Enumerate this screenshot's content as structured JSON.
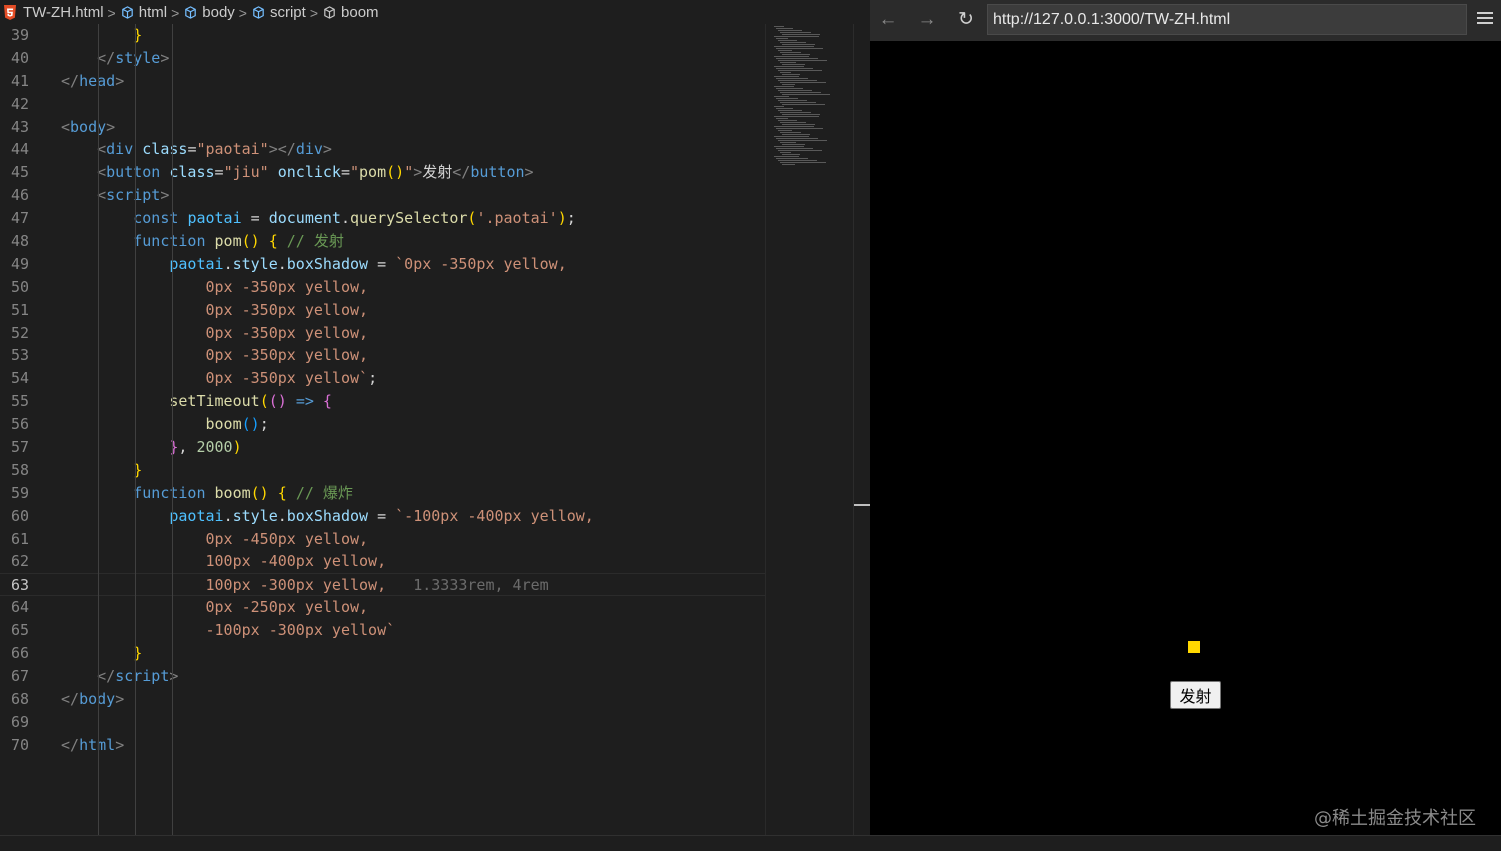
{
  "breadcrumb": {
    "file": "TW-ZH.html",
    "items": [
      "html",
      "body",
      "script",
      "boom"
    ]
  },
  "code_lines": [
    {
      "n": "39",
      "html": "        <span class=\"br\">}</span>"
    },
    {
      "n": "40",
      "html": "    <span class=\"t\">&lt;/</span><span class=\"tn\">style</span><span class=\"t\">&gt;</span>"
    },
    {
      "n": "41",
      "html": "<span class=\"t\">&lt;/</span><span class=\"tn\">head</span><span class=\"t\">&gt;</span>"
    },
    {
      "n": "42",
      "html": ""
    },
    {
      "n": "43",
      "html": "<span class=\"t\">&lt;</span><span class=\"tn\">body</span><span class=\"t\">&gt;</span>"
    },
    {
      "n": "44",
      "html": "    <span class=\"t\">&lt;</span><span class=\"tn\">div</span> <span class=\"an\">class</span>=<span class=\"av\">\"paotai\"</span><span class=\"t\">&gt;&lt;/</span><span class=\"tn\">div</span><span class=\"t\">&gt;</span>"
    },
    {
      "n": "45",
      "html": "    <span class=\"t\">&lt;</span><span class=\"tn\">button</span> <span class=\"an\">class</span>=<span class=\"av\">\"jiu\"</span> <span class=\"an\">onclick</span>=<span class=\"av\">\"</span><span class=\"fn\">pom</span><span class=\"br\">()</span><span class=\"av\">\"</span><span class=\"t\">&gt;</span>发射<span class=\"t\">&lt;/</span><span class=\"tn\">button</span><span class=\"t\">&gt;</span>"
    },
    {
      "n": "46",
      "html": "    <span class=\"t\">&lt;</span><span class=\"tn\">script</span><span class=\"t\">&gt;</span>"
    },
    {
      "n": "47",
      "html": "        <span class=\"kw\">const</span> <span class=\"vr\">paotai</span> = <span class=\"pr\">document</span>.<span class=\"fn\">querySelector</span><span class=\"br\">(</span><span class=\"av\">'.paotai'</span><span class=\"br\">)</span>;"
    },
    {
      "n": "48",
      "html": "        <span class=\"kw\">function</span> <span class=\"fn\">pom</span><span class=\"br\">()</span> <span class=\"br\">{</span> <span class=\"cm\">// 发射</span>"
    },
    {
      "n": "49",
      "html": "            <span class=\"vr\">paotai</span>.<span class=\"pr\">style</span>.<span class=\"pr\">boxShadow</span> = <span class=\"av\">`0px -350px yellow,</span>"
    },
    {
      "n": "50",
      "html": "                <span class=\"av\">0px -350px yellow,</span>"
    },
    {
      "n": "51",
      "html": "                <span class=\"av\">0px -350px yellow,</span>"
    },
    {
      "n": "52",
      "html": "                <span class=\"av\">0px -350px yellow,</span>"
    },
    {
      "n": "53",
      "html": "                <span class=\"av\">0px -350px yellow,</span>"
    },
    {
      "n": "54",
      "html": "                <span class=\"av\">0px -350px yellow`</span>;"
    },
    {
      "n": "55",
      "html": "            <span class=\"fn\">setTimeout</span><span class=\"br\">(</span><span class=\"bp\">()</span> <span class=\"kw\">=&gt;</span> <span class=\"bp\">{</span>"
    },
    {
      "n": "56",
      "html": "                <span class=\"fn\">boom</span><span class=\"bb\">()</span>;"
    },
    {
      "n": "57",
      "html": "            <span class=\"bp\">}</span>, <span class=\"nm\">2000</span><span class=\"br\">)</span>"
    },
    {
      "n": "58",
      "html": "        <span class=\"br\">}</span>"
    },
    {
      "n": "59",
      "html": "        <span class=\"kw\">function</span> <span class=\"fn\">boom</span><span class=\"br\">()</span> <span class=\"br\">{</span> <span class=\"cm\">// 爆炸</span>"
    },
    {
      "n": "60",
      "html": "            <span class=\"vr\">paotai</span>.<span class=\"pr\">style</span>.<span class=\"pr\">boxShadow</span> = <span class=\"av\">`-100px -400px yellow,</span>"
    },
    {
      "n": "61",
      "html": "                <span class=\"av\">0px -450px yellow,</span>"
    },
    {
      "n": "62",
      "html": "                <span class=\"av\">100px -400px yellow,</span>"
    },
    {
      "n": "63",
      "html": "                <span class=\"av\">100px -300px yellow,</span>   <span class=\"hint\">1.3333rem, 4rem</span>",
      "current": true
    },
    {
      "n": "64",
      "html": "                <span class=\"av\">0px -250px yellow,</span>"
    },
    {
      "n": "65",
      "html": "                <span class=\"av\">-100px -300px yellow`</span>"
    },
    {
      "n": "66",
      "html": "        <span class=\"br\">}</span>"
    },
    {
      "n": "67",
      "html": "    <span class=\"t\">&lt;/</span><span class=\"tn\">script</span><span class=\"t\">&gt;</span>"
    },
    {
      "n": "68",
      "html": "<span class=\"t\">&lt;/</span><span class=\"tn\">body</span><span class=\"t\">&gt;</span>"
    },
    {
      "n": "69",
      "html": ""
    },
    {
      "n": "70",
      "html": "<span class=\"t\">&lt;/</span><span class=\"tn\">html</span><span class=\"t\">&gt;</span>"
    }
  ],
  "browser": {
    "url": "http://127.0.0.1:3000/TW-ZH.html",
    "fire_button_label": "发射",
    "watermark": "@稀土掘金技术社区"
  },
  "colors": {
    "shell_yellow": "#ffd700",
    "page_background": "#000000",
    "editor_background": "#1e1e1e"
  }
}
